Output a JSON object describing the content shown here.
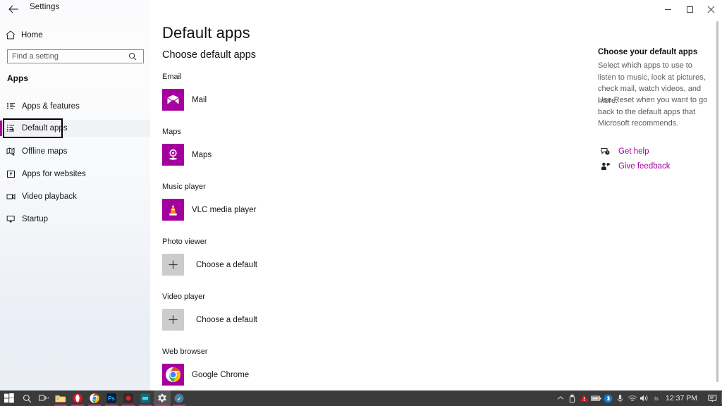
{
  "titlebar": {
    "back_icon": "back-arrow-icon",
    "title": "Settings",
    "minimize_label": "Minimize",
    "maximize_label": "Maximize",
    "close_label": "Close"
  },
  "sidebar": {
    "home": {
      "icon": "home-icon",
      "label": "Home"
    },
    "search": {
      "icon": "search-icon",
      "placeholder": "Find a setting",
      "value": ""
    },
    "group_header": "Apps",
    "items": [
      {
        "icon": "apps-features-icon",
        "label": "Apps & features",
        "selected": false
      },
      {
        "icon": "default-apps-icon",
        "label": "Default apps",
        "selected": true
      },
      {
        "icon": "offline-maps-icon",
        "label": "Offline maps",
        "selected": false
      },
      {
        "icon": "apps-websites-icon",
        "label": "Apps for websites",
        "selected": false
      },
      {
        "icon": "video-playback-icon",
        "label": "Video playback",
        "selected": false
      },
      {
        "icon": "startup-icon",
        "label": "Startup",
        "selected": false
      }
    ],
    "accent_color": "#b4009e"
  },
  "main": {
    "page_title": "Default apps",
    "section_title": "Choose default apps",
    "sections": [
      {
        "label": "Email",
        "app": "Mail",
        "icon": "mail-app-icon",
        "tile": "magenta",
        "top_label": 103,
        "top_app": 126
      },
      {
        "label": "Maps",
        "app": "Maps",
        "icon": "maps-app-icon",
        "tile": "magenta",
        "top_label": 181,
        "top_app": 204
      },
      {
        "label": "Music player",
        "app": "VLC media player",
        "icon": "vlc-app-icon",
        "tile": "magenta",
        "top_label": 259,
        "top_app": 282
      },
      {
        "label": "Photo viewer",
        "app": "Choose a default",
        "icon": "plus-icon",
        "tile": "grey",
        "top_label": 337,
        "top_app": 360
      },
      {
        "label": "Video player",
        "app": "Choose a default",
        "icon": "plus-icon",
        "tile": "grey",
        "top_label": 415,
        "top_app": 438
      },
      {
        "label": "Web browser",
        "app": "Google Chrome",
        "icon": "chrome-app-icon",
        "tile": "magenta",
        "top_label": 493,
        "top_app": 516
      }
    ]
  },
  "help_rail": {
    "heading": "Choose your default apps",
    "paragraph1": "Select which apps to use to listen to music, look at pictures, check mail, watch videos, and more.",
    "paragraph2": "Use Reset when you want to go back to the default apps that Microsoft recommends.",
    "links": [
      {
        "icon": "get-help-icon",
        "label": "Get help"
      },
      {
        "icon": "give-feedback-icon",
        "label": "Give feedback"
      }
    ],
    "link_color": "#a4009e"
  },
  "taskbar": {
    "items": [
      {
        "name": "start-button",
        "running": false
      },
      {
        "name": "search-button",
        "running": false
      },
      {
        "name": "task-view-button",
        "running": false
      },
      {
        "name": "file-explorer",
        "running": true
      },
      {
        "name": "opera-browser",
        "running": true
      },
      {
        "name": "google-chrome",
        "running": true
      },
      {
        "name": "photoshop",
        "running": true
      },
      {
        "name": "recorder-app",
        "running": true
      },
      {
        "name": "teal-app",
        "running": true
      },
      {
        "name": "settings-app",
        "running": true,
        "active": true
      },
      {
        "name": "compass-app",
        "running": true
      }
    ],
    "tray": [
      "show-hidden-icons-icon",
      "usb-icon",
      "warning-icon",
      "battery-icon",
      "bluetooth-icon",
      "microphone-icon",
      "wifi-icon",
      "volume-icon",
      "language-icon"
    ],
    "clock": "12:37 PM",
    "notifications_icon": "notifications-icon"
  }
}
